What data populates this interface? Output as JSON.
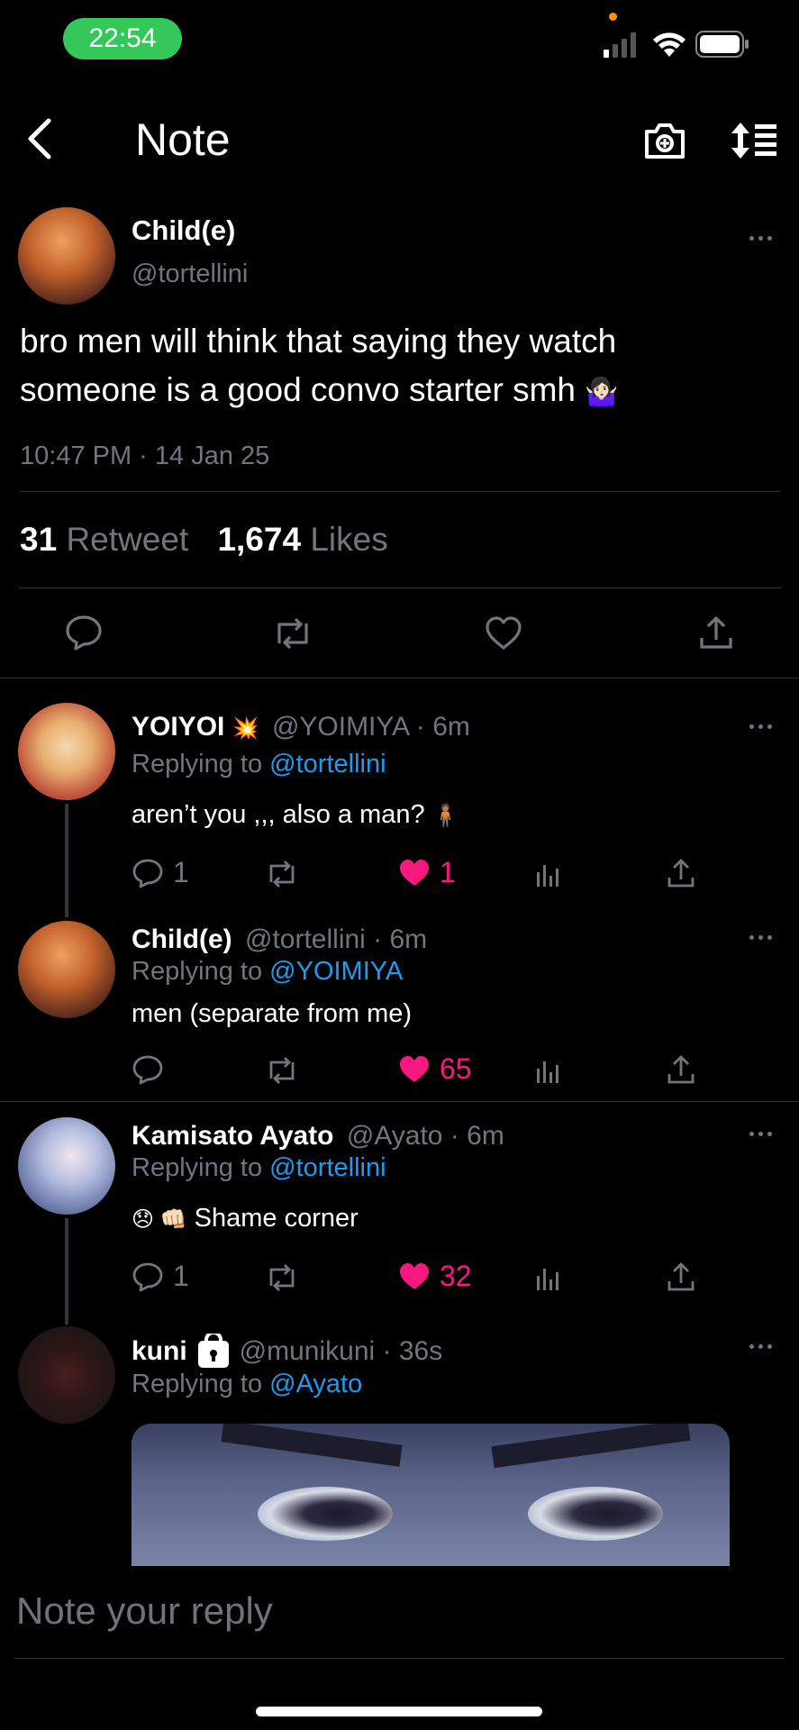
{
  "status_bar": {
    "time": "22:54"
  },
  "header": {
    "title": "Note"
  },
  "main_post": {
    "display_name": "Child(e)",
    "handle": "@tortellini",
    "text_line1": "bro men will think that saying they watch",
    "text_line2": "someone is a good convo starter smh",
    "emoji": "🤷🏻‍♀️",
    "timestamp": "10:47 PM · 14 Jan 25",
    "retweet_count": "31",
    "retweet_label": "Retweet",
    "likes_count": "1,674",
    "likes_label": "Likes"
  },
  "replies": [
    {
      "display_name": "YOIYOI",
      "name_emoji": "💥",
      "handle_time": "@YOIMIYA · 6m",
      "replying_prefix": "Replying to",
      "replying_to": "@tortellini",
      "text": "aren’t you ,,, also a man?",
      "text_emoji": "🧍🏽",
      "reply_count": "1",
      "like_count": "1"
    },
    {
      "display_name": "Child(e)",
      "handle_time": "@tortellini · 6m",
      "replying_prefix": "Replying to",
      "replying_to": "@YOIMIYA",
      "text": "men (separate from me)",
      "reply_count": "",
      "like_count": "65"
    },
    {
      "display_name": "Kamisato Ayato",
      "handle_time": "@Ayato · 6m",
      "replying_prefix": "Replying to",
      "replying_to": "@tortellini",
      "text_emoji": "😞 👊🏻",
      "text": "Shame corner",
      "reply_count": "1",
      "like_count": "32"
    },
    {
      "display_name": "kuni",
      "handle_time": "@munikuni · 36s",
      "replying_prefix": "Replying to",
      "replying_to": "@Ayato"
    }
  ],
  "composer": {
    "placeholder": "Note your reply"
  },
  "colors": {
    "accent": "#1d9bf0",
    "like": "#f91880",
    "muted": "#71767b",
    "status_pill": "#34c759"
  }
}
